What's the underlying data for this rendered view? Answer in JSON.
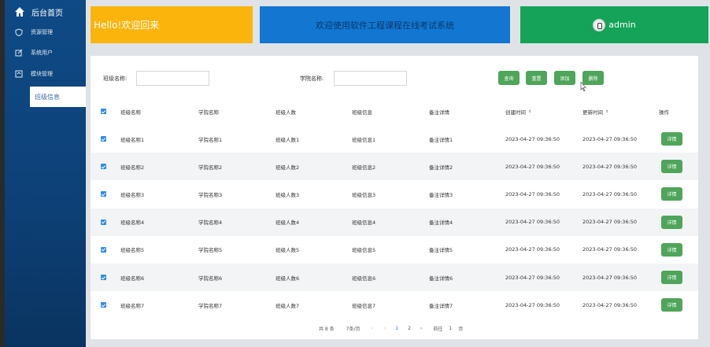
{
  "sidebar": {
    "home": "后台首页",
    "items": [
      {
        "label": "资源管理",
        "icon": "shield-icon"
      },
      {
        "label": "系统用户",
        "icon": "edit-icon"
      },
      {
        "label": "模块管理",
        "icon": "module-icon"
      }
    ],
    "active": "班级信息"
  },
  "banner": {
    "welcome": "Hello!欢迎回来",
    "system": "欢迎使用软件工程课程在线考试系统",
    "user": "admin"
  },
  "search": {
    "class_label": "班级名称:",
    "college_label": "学院名称:",
    "class_value": "",
    "college_value": ""
  },
  "toolbar": {
    "query": "查询",
    "reset": "重置",
    "add": "添加",
    "delete": "删除"
  },
  "table": {
    "columns": [
      "班级名称",
      "学院名称",
      "班级人数",
      "班级信息",
      "备注详情",
      "创建时间",
      "更新时间",
      "操作"
    ],
    "rows": [
      [
        "班级名称1",
        "学院名称1",
        "班级人数1",
        "班级信息1",
        "备注详情1",
        "2023-04-27 09:36:50",
        "2023-04-27 09:36:50",
        "详情"
      ],
      [
        "班级名称2",
        "学院名称2",
        "班级人数2",
        "班级信息2",
        "备注详情2",
        "2023-04-27 09:36:50",
        "2023-04-27 09:36:50",
        "详情"
      ],
      [
        "班级名称3",
        "学院名称3",
        "班级人数3",
        "班级信息3",
        "备注详情3",
        "2023-04-27 09:36:50",
        "2023-04-27 09:36:50",
        "详情"
      ],
      [
        "班级名称4",
        "学院名称4",
        "班级人数4",
        "班级信息4",
        "备注详情4",
        "2023-04-27 09:36:50",
        "2023-04-27 09:36:50",
        "详情"
      ],
      [
        "班级名称5",
        "学院名称5",
        "班级人数5",
        "班级信息5",
        "备注详情5",
        "2023-04-27 09:36:50",
        "2023-04-27 09:36:50",
        "详情"
      ],
      [
        "班级名称6",
        "学院名称6",
        "班级人数6",
        "班级信息6",
        "备注详情6",
        "2023-04-27 09:36:50",
        "2023-04-27 09:36:50",
        "详情"
      ],
      [
        "班级名称7",
        "学院名称7",
        "班级人数7",
        "班级信息7",
        "备注详情7",
        "2023-04-27 09:36:50",
        "2023-04-27 09:36:50",
        "详情"
      ]
    ]
  },
  "pager": {
    "total": "共 8 条",
    "page_size": "7条/页",
    "page1": "1",
    "page2": "2",
    "goto": "前往",
    "goto_value": "1",
    "page_unit": "页"
  },
  "colors": {
    "card_yellow": "#fbb40b",
    "card_blue": "#1376d1",
    "card_green": "#15a35a",
    "button_green": "#4fa55a",
    "sidebar_blue": "#0f4a86"
  }
}
